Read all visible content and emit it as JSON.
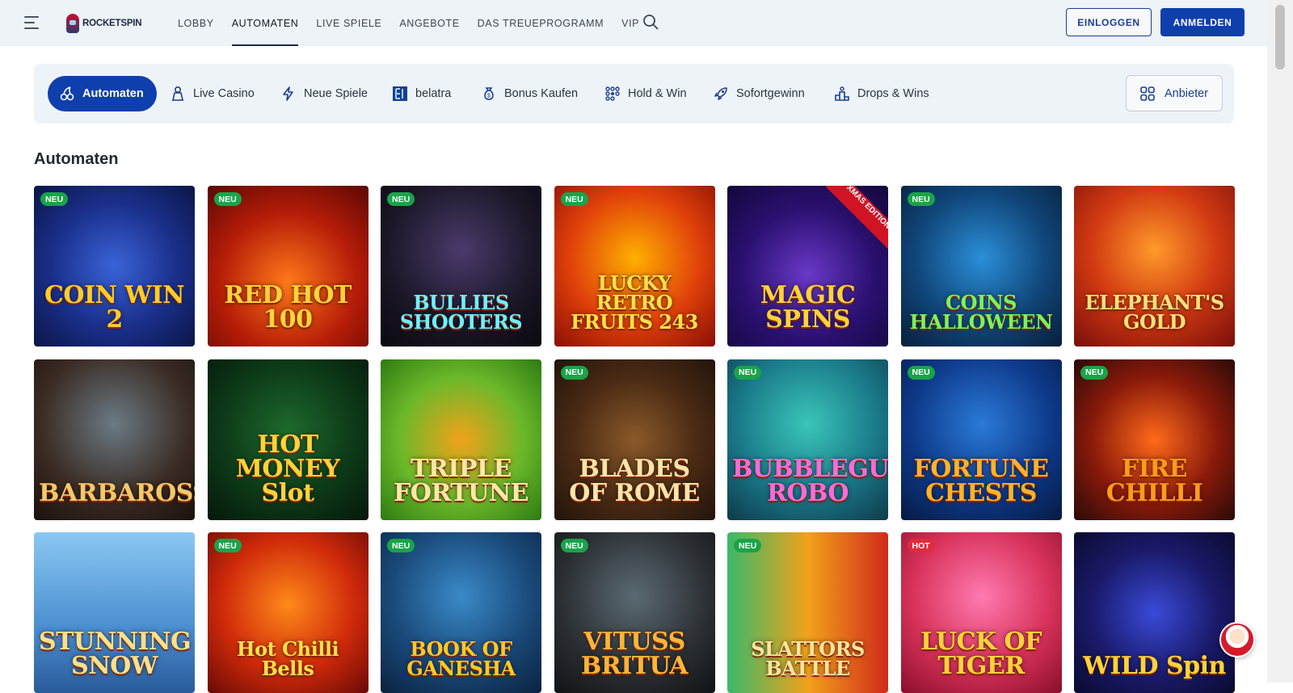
{
  "header": {
    "logo_text": "ROCKETSPIN",
    "nav": [
      {
        "label": "LOBBY",
        "active": false
      },
      {
        "label": "AUTOMATEN",
        "active": true
      },
      {
        "label": "LIVE SPIELE",
        "active": false
      },
      {
        "label": "ANGEBOTE",
        "active": false
      },
      {
        "label": "DAS TREUEPROGRAMM",
        "active": false
      },
      {
        "label": "VIP",
        "active": false
      }
    ],
    "login_label": "EINLOGGEN",
    "register_label": "ANMELDEN"
  },
  "categories": [
    {
      "label": "Automaten",
      "icon": "cherries-icon",
      "active": true
    },
    {
      "label": "Live Casino",
      "icon": "dealer-icon",
      "active": false
    },
    {
      "label": "Neue Spiele",
      "icon": "lightning-icon",
      "active": false
    },
    {
      "label": "belatra",
      "icon": "belatra-logo-icon",
      "active": false
    },
    {
      "label": "Bonus Kaufen",
      "icon": "money-bag-icon",
      "active": false
    },
    {
      "label": "Hold & Win",
      "icon": "dots-grid-icon",
      "active": false
    },
    {
      "label": "Sofortgewinn",
      "icon": "rocket-icon",
      "active": false
    },
    {
      "label": "Drops & Wins",
      "icon": "podium-icon",
      "active": false
    }
  ],
  "anbieter_label": "Anbieter",
  "section_title": "Automaten",
  "colors": {
    "primary": "#0f3fad",
    "badge_new": "#1aa34a",
    "badge_hot": "#e02b3d",
    "header_bg": "#eef3f8"
  },
  "games": [
    {
      "title": "COIN WIN 2",
      "badge": "NEU",
      "bg": "radial-gradient(circle at 50% 50%, #3a63d8 0%, #1a2f8a 55%, #0b1546 100%)",
      "color": "#ffcc2a"
    },
    {
      "title": "RED HOT 100",
      "badge": "NEU",
      "bg": "radial-gradient(circle at 50% 60%, #ff7a1a 0%, #b51c08 55%, #5a0804 100%)",
      "color": "#ffd23a"
    },
    {
      "title": "BULLIES SHOOTERS",
      "badge": "NEU",
      "bg": "radial-gradient(circle at 50% 40%, #4a3a6a 0%, #1a1626 60%, #0a0910 100%)",
      "color": "#6ef0ff"
    },
    {
      "title": "LUCKY RETRO FRUITS 243",
      "badge": "NEU",
      "bg": "radial-gradient(circle at 50% 45%, #ffb000 0%, #e0400a 55%, #8a0e06 100%)",
      "color": "#ffe14a"
    },
    {
      "title": "MAGIC SPINS",
      "badge": "",
      "ribbon": "XMAS EDITION",
      "bg": "radial-gradient(circle at 50% 55%, #6a38c8 0%, #2a1070 55%, #12073a 100%)",
      "color": "#ffd23a"
    },
    {
      "title": "COINS HALLOWEEN",
      "badge": "NEU",
      "bg": "radial-gradient(circle at 50% 45%, #2b8fd8 0%, #10467a 55%, #081f3a 100%)",
      "color": "#7df25a"
    },
    {
      "title": "ELEPHANT'S GOLD",
      "badge": "",
      "bg": "radial-gradient(circle at 50% 40%, #ff9a2a 0%, #d23a12 50%, #7a0e0a 100%)",
      "color": "#ffe07a"
    },
    {
      "title": "BARBAROSSA",
      "badge": "",
      "bg": "radial-gradient(circle at 50% 40%, #6a7a84 0%, #3a2a22 60%, #1a120e 100%)",
      "color": "#f2c869"
    },
    {
      "title": "HOT MONEY Slot",
      "badge": "",
      "bg": "radial-gradient(circle at 50% 45%, #1e6a2e 0%, #0d3a18 55%, #05180a 100%)",
      "color": "#ffd23a"
    },
    {
      "title": "TRIPLE FORTUNE",
      "badge": "",
      "bg": "radial-gradient(circle at 50% 50%, #f2a21a 0%, #6ab82a 55%, #2e7a12 100%)",
      "color": "#ffe8a8"
    },
    {
      "title": "BLADES OF ROME",
      "badge": "NEU",
      "bg": "radial-gradient(circle at 50% 50%, #8a5a2a 0%, #4a2a14 55%, #22140a 100%)",
      "color": "#ffe4a8"
    },
    {
      "title": "BUBBLEGUM ROBO",
      "badge": "NEU",
      "bg": "radial-gradient(circle at 50% 40%, #3ac6b8 0%, #1a7a8a 55%, #0e3a4a 100%)",
      "color": "#ff6ad8"
    },
    {
      "title": "FORTUNE CHESTS",
      "badge": "NEU",
      "bg": "radial-gradient(circle at 50% 40%, #2a7ad8 0%, #0e3a8a 55%, #061a44 100%)",
      "color": "#ffb22a"
    },
    {
      "title": "FIRE CHILLI",
      "badge": "NEU",
      "bg": "radial-gradient(circle at 50% 50%, #ff6a1a 0%, #8a1a0a 55%, #2a0a08 100%)",
      "color": "#ff9a1a"
    },
    {
      "title": "STUNNING SNOW",
      "badge": "",
      "bg": "linear-gradient(180deg, #8ac8f2 0%, #4a8ed0 60%, #2a5a9a 100%)",
      "color": "#ffe08a"
    },
    {
      "title": "Hot Chilli Bells",
      "badge": "NEU",
      "bg": "radial-gradient(circle at 50% 45%, #ff8a1a 0%, #d02a0a 55%, #6a0a06 100%)",
      "color": "#ffe04a"
    },
    {
      "title": "BOOK OF GANESHA",
      "badge": "NEU",
      "bg": "radial-gradient(circle at 50% 40%, #3a8ac8 0%, #1a4a7a 55%, #0a2240 100%)",
      "color": "#ffc82a"
    },
    {
      "title": "VITUSS BRITUA",
      "badge": "NEU",
      "bg": "radial-gradient(circle at 50% 40%, #5a6a72 0%, #2a2e32 60%, #111315 100%)",
      "color": "#ffb43a"
    },
    {
      "title": "SLATTORS BATTLE",
      "badge": "NEU",
      "bg": "linear-gradient(90deg, #3ab86a 0%, #f2a21a 50%, #d02a1a 100%)",
      "color": "#ffe4a0"
    },
    {
      "title": "LUCK OF TIGER",
      "badge": "HOT",
      "bg": "radial-gradient(circle at 50% 40%, #ff7ab0 0%, #d8325a 55%, #8a0e2a 100%)",
      "color": "#ffd23a"
    },
    {
      "title": "WILD Spin",
      "badge": "",
      "bg": "radial-gradient(circle at 50% 50%, #3a4ad8 0%, #1a1a6a 55%, #0a0a30 100%)",
      "color": "#ffd23a"
    }
  ]
}
